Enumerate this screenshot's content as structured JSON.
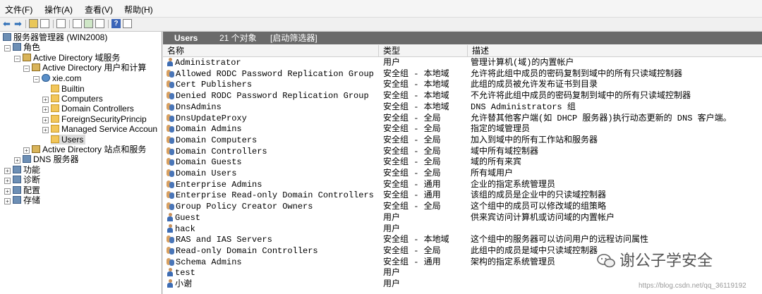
{
  "menubar": [
    "文件(F)",
    "操作(A)",
    "查看(V)",
    "帮助(H)"
  ],
  "tree": {
    "root": "服务器管理器 (WIN2008)",
    "roles": "角色",
    "ad_ds": "Active Directory 域服务",
    "ad_users": "Active Directory 用户和计算",
    "domain": "xie.com",
    "builtin": "Builtin",
    "computers": "Computers",
    "dcs": "Domain Controllers",
    "fsp": "ForeignSecurityPrincip",
    "msa": "Managed Service Accoun",
    "users": "Users",
    "ad_sites": "Active Directory 站点和服务",
    "dns": "DNS 服务器",
    "features": "功能",
    "diagnostics": "诊断",
    "configuration": "配置",
    "storage": "存储"
  },
  "panel": {
    "title": "Users",
    "count": "21 个对象",
    "filter": "[启动筛选器]"
  },
  "columns": {
    "name": "名称",
    "type": "类型",
    "desc": "描述"
  },
  "rows": [
    {
      "icon": "user",
      "name": "Administrator",
      "type": "用户",
      "desc": "管理计算机(域)的内置帐户"
    },
    {
      "icon": "group",
      "name": "Allowed RODC Password Replication Group",
      "type": "安全组 - 本地域",
      "desc": "允许将此组中成员的密码复制到域中的所有只读域控制器"
    },
    {
      "icon": "group",
      "name": "Cert Publishers",
      "type": "安全组 - 本地域",
      "desc": "此组的成员被允许发布证书到目录"
    },
    {
      "icon": "group",
      "name": "Denied RODC Password Replication Group",
      "type": "安全组 - 本地域",
      "desc": "不允许将此组中成员的密码复制到域中的所有只读域控制器"
    },
    {
      "icon": "group",
      "name": "DnsAdmins",
      "type": "安全组 - 本地域",
      "desc": "DNS Administrators 组"
    },
    {
      "icon": "group",
      "name": "DnsUpdateProxy",
      "type": "安全组 - 全局",
      "desc": "允许替其他客户端(如 DHCP 服务器)执行动态更新的 DNS 客户端。"
    },
    {
      "icon": "group",
      "name": "Domain Admins",
      "type": "安全组 - 全局",
      "desc": "指定的域管理员"
    },
    {
      "icon": "group",
      "name": "Domain Computers",
      "type": "安全组 - 全局",
      "desc": "加入到域中的所有工作站和服务器"
    },
    {
      "icon": "group",
      "name": "Domain Controllers",
      "type": "安全组 - 全局",
      "desc": "域中所有域控制器"
    },
    {
      "icon": "group",
      "name": "Domain Guests",
      "type": "安全组 - 全局",
      "desc": "域的所有来宾"
    },
    {
      "icon": "group",
      "name": "Domain Users",
      "type": "安全组 - 全局",
      "desc": "所有域用户"
    },
    {
      "icon": "group",
      "name": "Enterprise Admins",
      "type": "安全组 - 通用",
      "desc": "企业的指定系统管理员"
    },
    {
      "icon": "group",
      "name": "Enterprise Read-only Domain Controllers",
      "type": "安全组 - 通用",
      "desc": "该组的成员是企业中的只读域控制器"
    },
    {
      "icon": "group",
      "name": "Group Policy Creator Owners",
      "type": "安全组 - 全局",
      "desc": "这个组中的成员可以修改域的组策略"
    },
    {
      "icon": "user",
      "name": "Guest",
      "type": "用户",
      "desc": "供来宾访问计算机或访问域的内置帐户"
    },
    {
      "icon": "user",
      "name": "hack",
      "type": "用户",
      "desc": ""
    },
    {
      "icon": "group",
      "name": "RAS and IAS Servers",
      "type": "安全组 - 本地域",
      "desc": "这个组中的服务器可以访问用户的远程访问属性"
    },
    {
      "icon": "group",
      "name": "Read-only Domain Controllers",
      "type": "安全组 - 全局",
      "desc": "此组中的成员是域中只读域控制器"
    },
    {
      "icon": "group",
      "name": "Schema Admins",
      "type": "安全组 - 通用",
      "desc": "架构的指定系统管理员"
    },
    {
      "icon": "user",
      "name": "test",
      "type": "用户",
      "desc": ""
    },
    {
      "icon": "user",
      "name": "小谢",
      "type": "用户",
      "desc": ""
    }
  ],
  "watermark": {
    "text": "谢公子学安全",
    "url": "https://blog.csdn.net/qq_36119192"
  }
}
